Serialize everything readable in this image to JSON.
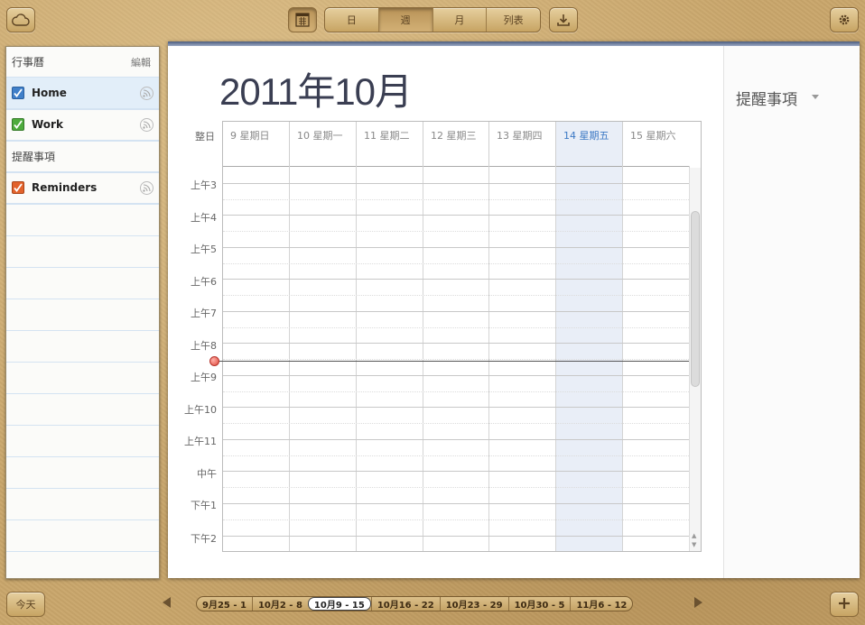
{
  "toolbar": {
    "views": [
      "日",
      "週",
      "月",
      "列表"
    ],
    "active_view": "週",
    "icons": [
      "cloud-icon",
      "calendar-list-icon",
      "download-icon",
      "gear-icon"
    ]
  },
  "sidebar": {
    "calendars_header": "行事曆",
    "edit_label": "編輯",
    "calendars": [
      {
        "label": "Home",
        "color": "#3f7fc9",
        "selected": true
      },
      {
        "label": "Work",
        "color": "#4eab3d",
        "selected": false
      }
    ],
    "reminders_header": "提醒事項",
    "reminder_lists": [
      {
        "label": "Reminders",
        "color": "#e2622b"
      }
    ]
  },
  "main": {
    "month_title": "2011年10月",
    "allday_label": "整日",
    "days": [
      {
        "label": "9 星期日",
        "today": false
      },
      {
        "label": "10 星期一",
        "today": false
      },
      {
        "label": "11 星期二",
        "today": false
      },
      {
        "label": "12 星期三",
        "today": false
      },
      {
        "label": "13 星期四",
        "today": false
      },
      {
        "label": "14 星期五",
        "today": true
      },
      {
        "label": "15 星期六",
        "today": false
      }
    ],
    "hours": [
      "上午3",
      "上午4",
      "上午5",
      "上午6",
      "上午7",
      "上午8",
      "上午9",
      "上午10",
      "上午11",
      "中午",
      "下午1",
      "下午2"
    ],
    "accent_today": "#3b78c4",
    "now_indicator_color": "#e0483c"
  },
  "reminders_pane": {
    "title": "提醒事項"
  },
  "bottom": {
    "today_label": "今天",
    "weeks": [
      "9月25 - 1",
      "10月2 - 8",
      "10月9 - 15",
      "10月16 - 22",
      "10月23 - 29",
      "10月30 - 5",
      "11月6 - 12"
    ],
    "active_week": "10月9 - 15"
  }
}
